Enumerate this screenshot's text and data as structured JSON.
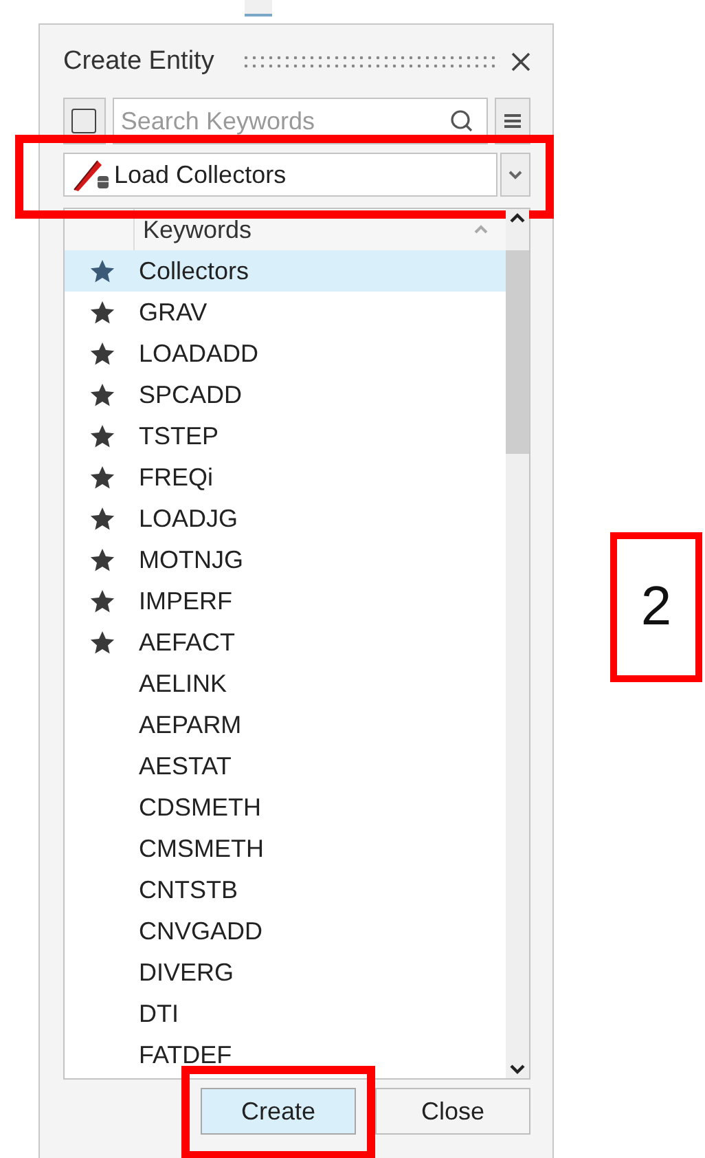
{
  "panel": {
    "title": "Create Entity"
  },
  "select_all": {
    "checked": false
  },
  "search": {
    "placeholder": "Search Keywords"
  },
  "type_dropdown": {
    "value": "Load Collectors",
    "highlighted": true
  },
  "list": {
    "header": "Keywords",
    "rows": [
      {
        "label": "Collectors",
        "starred": true,
        "selected": true
      },
      {
        "label": "GRAV",
        "starred": true,
        "selected": false
      },
      {
        "label": "LOADADD",
        "starred": true,
        "selected": false
      },
      {
        "label": "SPCADD",
        "starred": true,
        "selected": false
      },
      {
        "label": "TSTEP",
        "starred": true,
        "selected": false
      },
      {
        "label": "FREQi",
        "starred": true,
        "selected": false
      },
      {
        "label": "LOADJG",
        "starred": true,
        "selected": false
      },
      {
        "label": "MOTNJG",
        "starred": true,
        "selected": false
      },
      {
        "label": "IMPERF",
        "starred": true,
        "selected": false
      },
      {
        "label": "AEFACT",
        "starred": true,
        "selected": false
      },
      {
        "label": "AELINK",
        "starred": false,
        "selected": false
      },
      {
        "label": "AEPARM",
        "starred": false,
        "selected": false
      },
      {
        "label": "AESTAT",
        "starred": false,
        "selected": false
      },
      {
        "label": "CDSMETH",
        "starred": false,
        "selected": false
      },
      {
        "label": "CMSMETH",
        "starred": false,
        "selected": false
      },
      {
        "label": "CNTSTB",
        "starred": false,
        "selected": false
      },
      {
        "label": "CNVGADD",
        "starred": false,
        "selected": false
      },
      {
        "label": "DIVERG",
        "starred": false,
        "selected": false
      },
      {
        "label": "DTI",
        "starred": false,
        "selected": false
      },
      {
        "label": "FATDEF",
        "starred": false,
        "selected": false
      }
    ]
  },
  "buttons": [
    {
      "label": "Create",
      "primary": true,
      "highlighted": true
    },
    {
      "label": "Close",
      "primary": false,
      "highlighted": false
    }
  ],
  "callout": {
    "text": "2"
  }
}
